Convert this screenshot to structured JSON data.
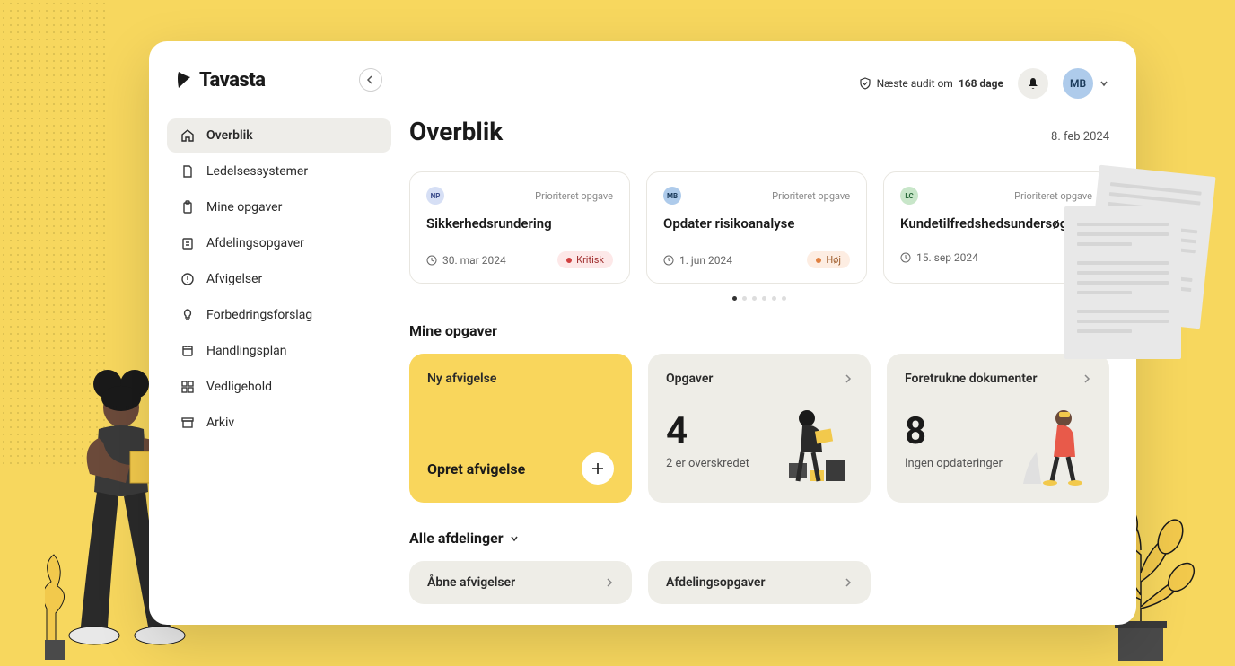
{
  "brand": "Tavasta",
  "header": {
    "audit_prefix": "Næste audit om",
    "audit_days": "168 dage",
    "user_initials": "MB"
  },
  "sidebar": {
    "items": [
      {
        "label": "Overblik"
      },
      {
        "label": "Ledelsessystemer"
      },
      {
        "label": "Mine opgaver"
      },
      {
        "label": "Afdelingsopgaver"
      },
      {
        "label": "Afvigelser"
      },
      {
        "label": "Forbedringsforslag"
      },
      {
        "label": "Handlingsplan"
      },
      {
        "label": "Vedligehold"
      },
      {
        "label": "Arkiv"
      }
    ]
  },
  "page": {
    "title": "Overblik",
    "date": "8. feb 2024"
  },
  "priority_cards": [
    {
      "avatar": "NP",
      "badge": "Prioriteret opgave",
      "title": "Sikkerhedsrundering",
      "date": "30. mar 2024",
      "severity": "Kritisk"
    },
    {
      "avatar": "MB",
      "badge": "Prioriteret opgave",
      "title": "Opdater risikoanalyse",
      "date": "1. jun 2024",
      "severity": "Høj"
    },
    {
      "avatar": "LC",
      "badge": "Prioriteret opgave",
      "title": "Kundetilfredshedsundersøgelse",
      "date": "15. sep 2024",
      "severity": ""
    }
  ],
  "sections": {
    "mine_opgaver": "Mine opgaver",
    "alle_afdelinger": "Alle afdelinger"
  },
  "tiles": {
    "deviation_new": "Ny afvigelse",
    "deviation_create": "Opret afvigelse",
    "tasks_label": "Opgaver",
    "tasks_count": "4",
    "tasks_sub": "2 er overskredet",
    "docs_label": "Foretrukne dokumenter",
    "docs_count": "8",
    "docs_sub": "Ingen opdateringer"
  },
  "bottom_tiles": {
    "open_deviations": "Åbne afvigelser",
    "dept_tasks": "Afdelingsopgaver"
  }
}
